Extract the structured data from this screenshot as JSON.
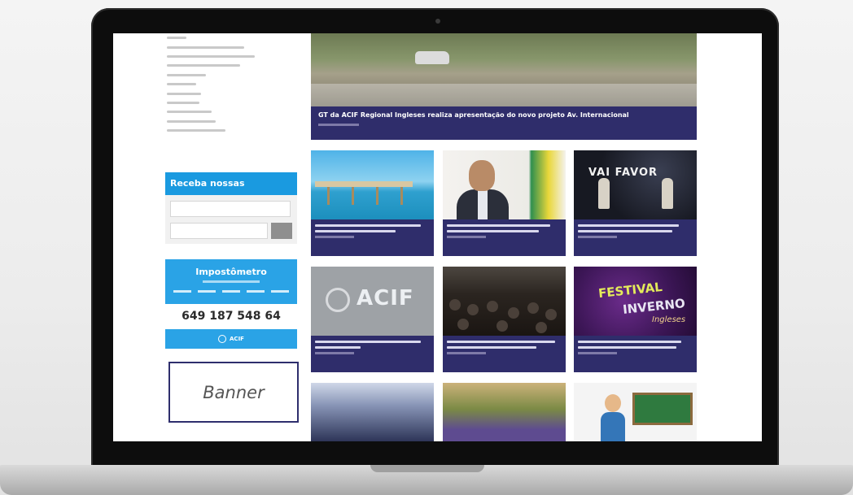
{
  "sidebar": {
    "categories": [
      {
        "label": "",
        "width": 24
      },
      {
        "label": "",
        "width": 95
      },
      {
        "label": "",
        "width": 108
      },
      {
        "label": "",
        "width": 90
      },
      {
        "label": "",
        "width": 48
      },
      {
        "label": "",
        "width": 36
      },
      {
        "label": "",
        "width": 42
      },
      {
        "label": "",
        "width": 40
      },
      {
        "label": "",
        "width": 55
      },
      {
        "label": "",
        "width": 60
      },
      {
        "label": "",
        "width": 72
      }
    ],
    "newsletter": {
      "title": "Receba nossas novidades",
      "email_placeholder": "",
      "city_placeholder": "",
      "submit_label": ""
    },
    "impostometro": {
      "title": "Impostômetro",
      "counter": "649 187 548  64"
    },
    "acif_label": "ACIF",
    "banner_label": "Banner"
  },
  "hero": {
    "title": "GT da ACIF Regional Ingleses realiza apresentação do novo projeto Av. Internacional",
    "date": ""
  },
  "colors": {
    "accent_blue": "#2aa3e6",
    "card_navy": "#2f2d6b",
    "banner_border": "#2e2e6d"
  },
  "cards": [
    {
      "image": "pier",
      "lines": 2
    },
    {
      "image": "man",
      "lines": 2
    },
    {
      "image": "stage",
      "lines": 2,
      "image_text": "VAI FAVOR"
    },
    {
      "image": "acif",
      "lines": 2,
      "image_text": "ACIF"
    },
    {
      "image": "crowd",
      "lines": 2
    },
    {
      "image": "festival",
      "lines": 2,
      "image_text": [
        "FESTIVAL",
        "INVERNO",
        "Ingleses"
      ]
    },
    {
      "image": "classroom"
    },
    {
      "image": "group"
    },
    {
      "image": "cartoon-teacher"
    }
  ]
}
